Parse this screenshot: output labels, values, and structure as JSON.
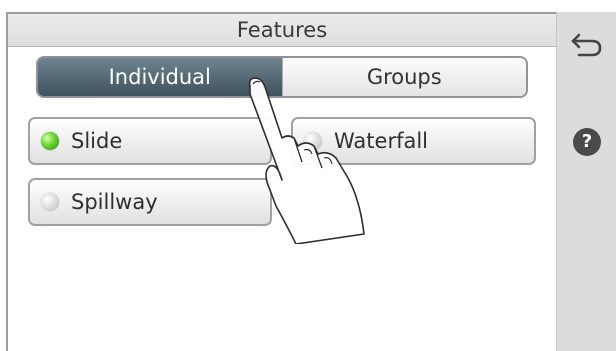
{
  "header": {
    "title": "Features"
  },
  "tabs": [
    {
      "label": "Individual",
      "active": true
    },
    {
      "label": "Groups",
      "active": false
    }
  ],
  "features": [
    {
      "label": "Slide",
      "status": "on"
    },
    {
      "label": "Waterfall",
      "status": "off"
    },
    {
      "label": "Spillway",
      "status": "off"
    }
  ],
  "sidebar": {
    "back_icon": "back-arrow-icon",
    "help_label": "?"
  },
  "colors": {
    "active_tab": "#4a5f6b",
    "led_on": "#5ccb2a",
    "led_off": "#cccccc",
    "sidebar_bg": "#dcdcdc"
  }
}
